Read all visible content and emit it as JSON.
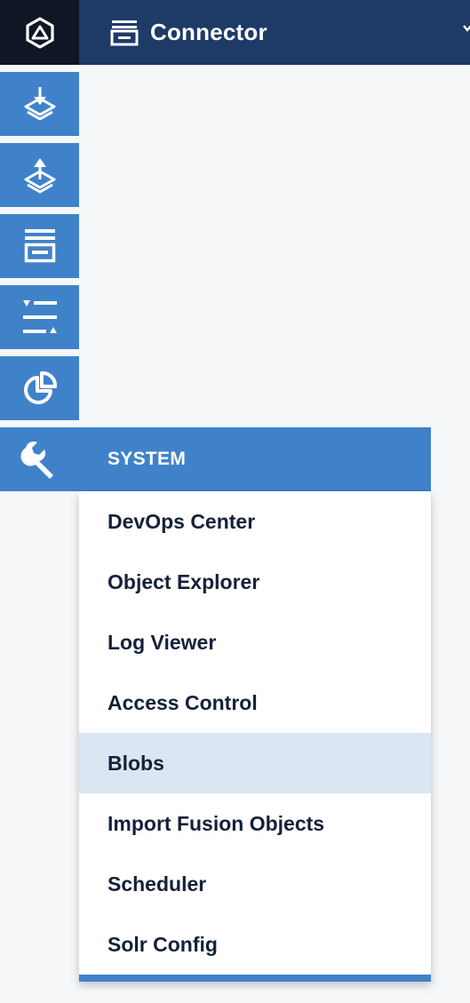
{
  "colors": {
    "topbar": "#1e3a66",
    "logo_bg": "#0f1724",
    "accent": "#4082c9",
    "selected_item_bg": "#dce6f3",
    "menu_text": "#14213a"
  },
  "header": {
    "logo_icon": "hexagon-triangle-logo-icon",
    "app_icon": "connector-stack-icon",
    "title": "Connector",
    "menu_icon": "chevron-down-icon"
  },
  "sidebar": {
    "items": [
      {
        "icon": "layers-download-icon"
      },
      {
        "icon": "layers-upload-icon"
      },
      {
        "icon": "connector-stack-icon"
      },
      {
        "icon": "sliders-icon"
      },
      {
        "icon": "pie-chart-icon"
      }
    ],
    "system": {
      "icon": "wrench-icon",
      "label": "SYSTEM"
    }
  },
  "system_menu": {
    "items": [
      {
        "label": "DevOps Center",
        "selected": false
      },
      {
        "label": "Object Explorer",
        "selected": false
      },
      {
        "label": "Log Viewer",
        "selected": false
      },
      {
        "label": "Access Control",
        "selected": false
      },
      {
        "label": "Blobs",
        "selected": true
      },
      {
        "label": "Import Fusion Objects",
        "selected": false
      },
      {
        "label": "Scheduler",
        "selected": false
      },
      {
        "label": "Solr Config",
        "selected": false
      }
    ]
  }
}
